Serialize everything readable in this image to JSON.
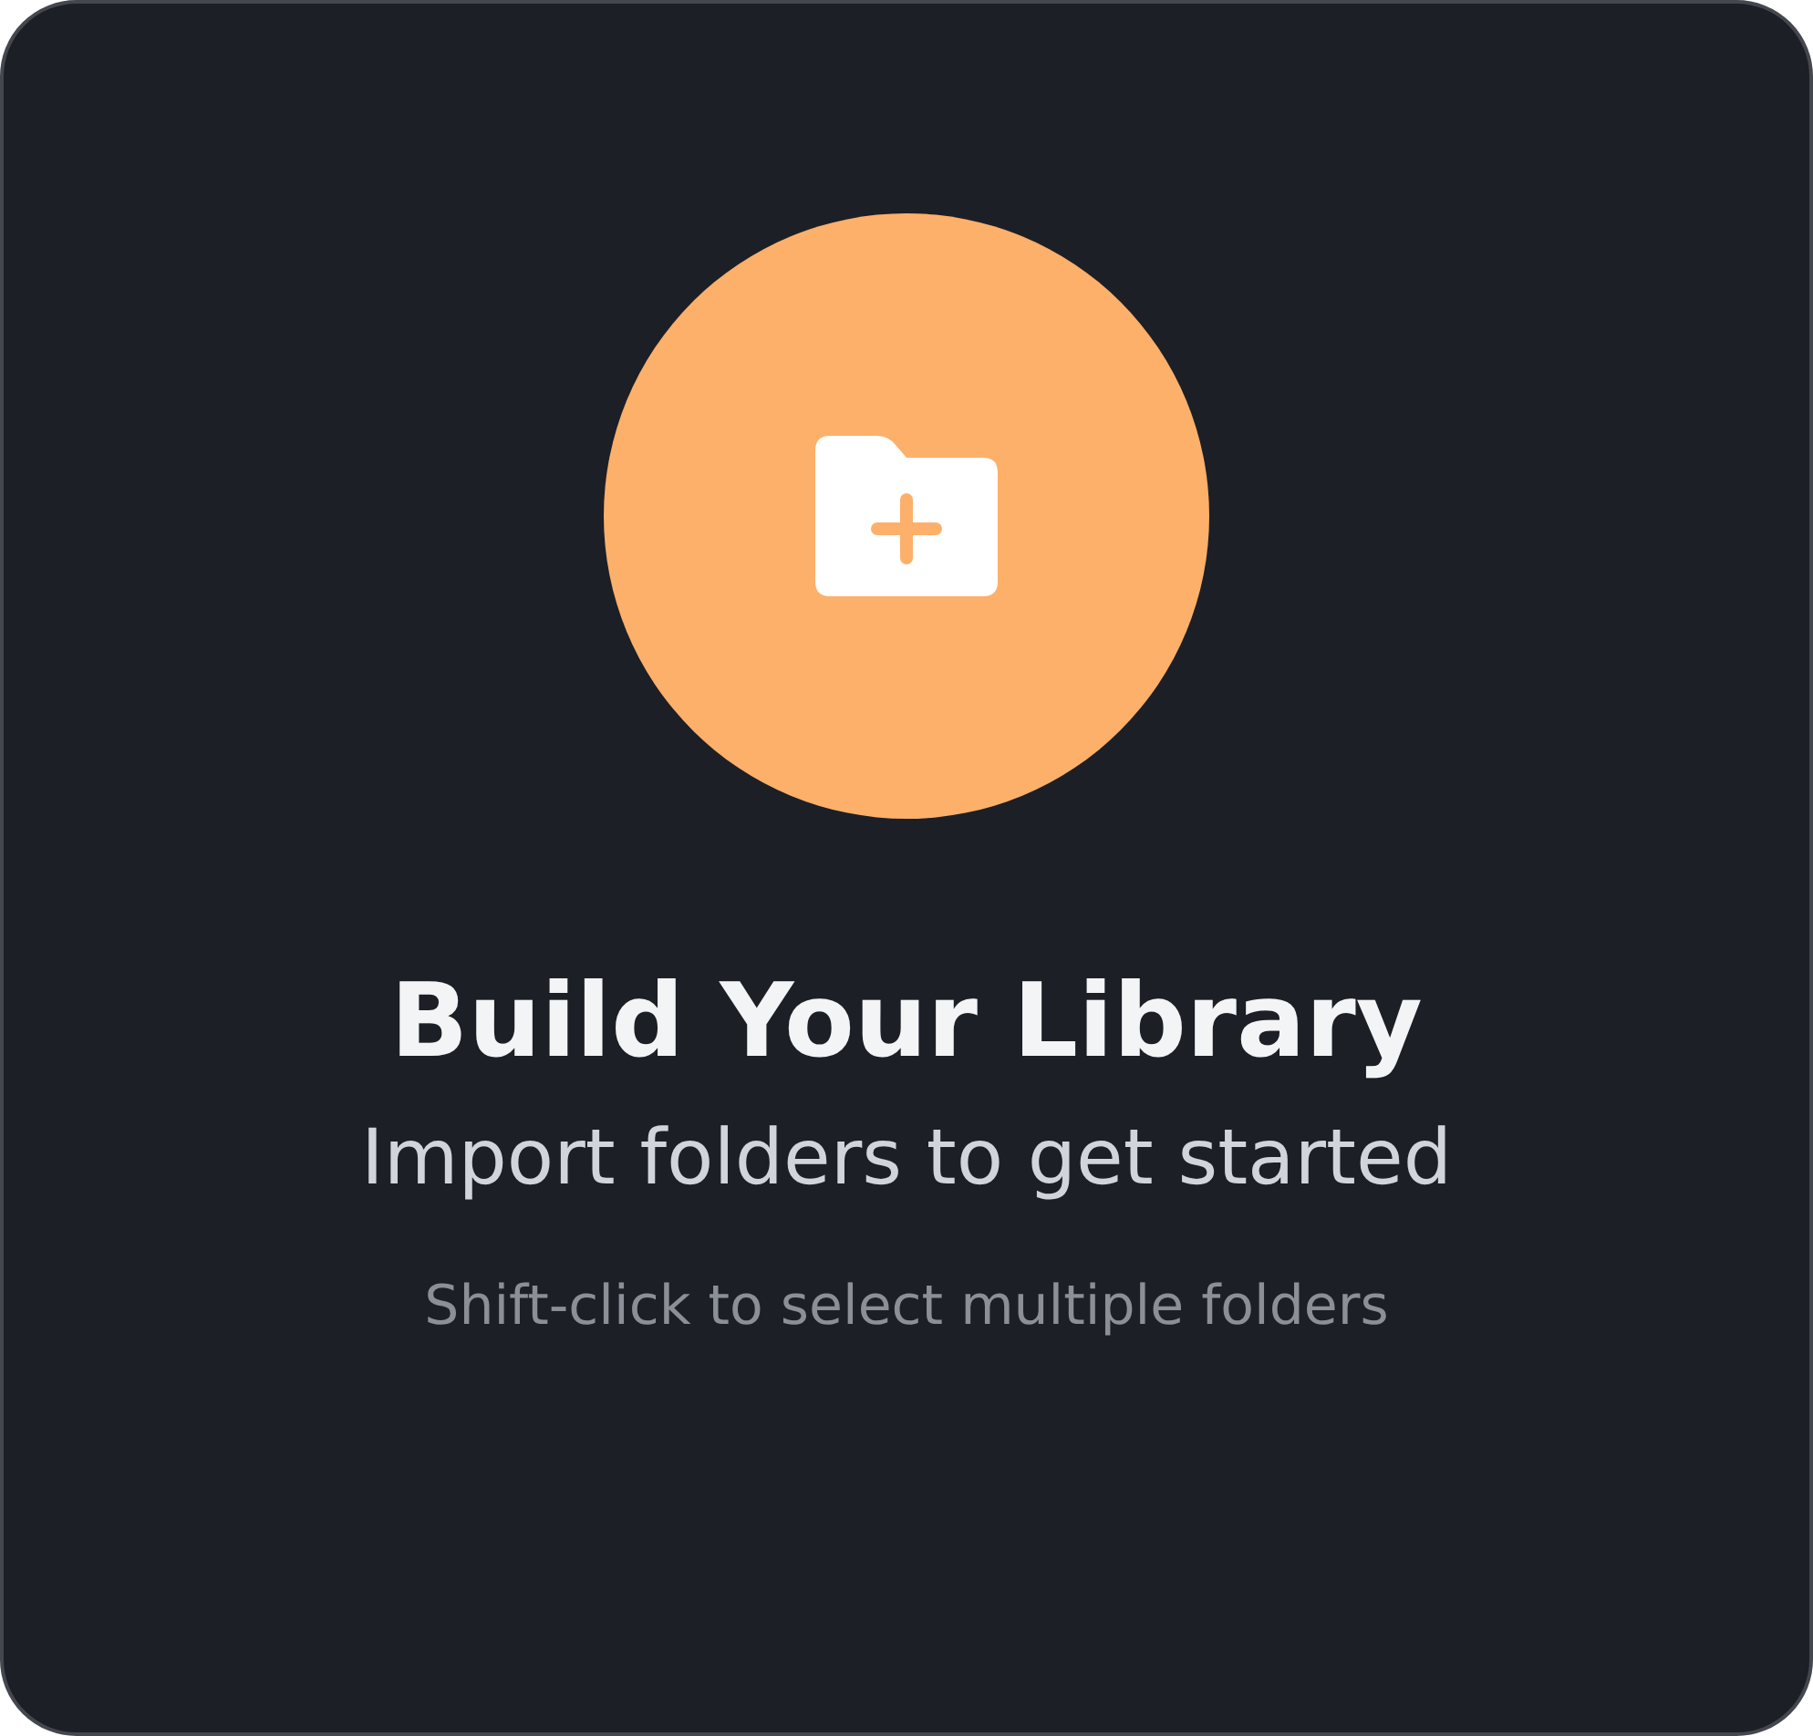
{
  "empty_state": {
    "title": "Build Your Library",
    "subtitle": "Import folders to get started",
    "hint": "Shift-click to select multiple folders"
  }
}
